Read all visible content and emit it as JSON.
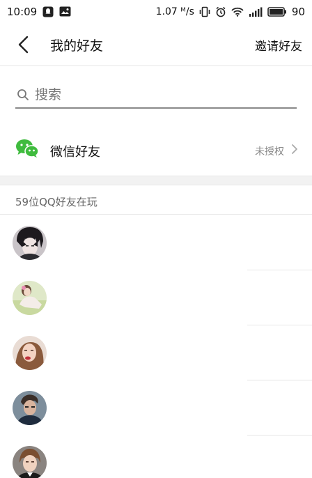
{
  "status_bar": {
    "time": "10:09",
    "speed": "1.07 ᴹ/s",
    "battery": "90"
  },
  "header": {
    "title": "我的好友",
    "invite_label": "邀请好友"
  },
  "search": {
    "placeholder": "搜索"
  },
  "wechat": {
    "label": "微信好友",
    "status": "未授权"
  },
  "friends_section": {
    "header": "59位QQ好友在玩"
  },
  "colors": {
    "wechat_green": "#3fbb3e",
    "divider": "#e6e6e6",
    "section_bg": "#f2f2f2"
  }
}
